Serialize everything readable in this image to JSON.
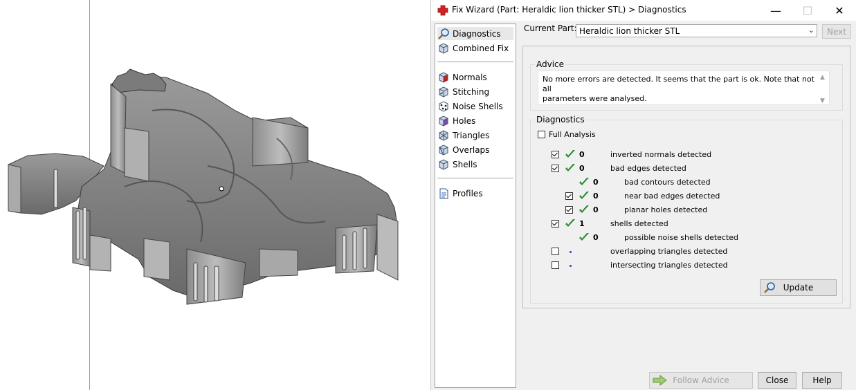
{
  "window": {
    "title": "Fix Wizard (Part: Heraldic lion thicker STL) > Diagnostics"
  },
  "nav": {
    "items": [
      {
        "label": "Diagnostics",
        "icon": "magnifier-icon"
      },
      {
        "label": "Combined Fix",
        "icon": "cube-icon"
      },
      {
        "label": "Normals",
        "icon": "normals-cube-icon"
      },
      {
        "label": "Stitching",
        "icon": "stitching-cube-icon"
      },
      {
        "label": "Noise Shells",
        "icon": "noise-shells-icon"
      },
      {
        "label": "Holes",
        "icon": "holes-cube-icon"
      },
      {
        "label": "Triangles",
        "icon": "triangles-cube-icon"
      },
      {
        "label": "Overlaps",
        "icon": "overlaps-cube-icon"
      },
      {
        "label": "Shells",
        "icon": "shells-cube-icon"
      },
      {
        "label": "Profiles",
        "icon": "profiles-document-icon"
      }
    ]
  },
  "current_part": {
    "label": "Current Part:",
    "value": "Heraldic lion thicker STL",
    "next_label": "Next"
  },
  "advice": {
    "title": "Advice",
    "line1": "No more errors are detected. It seems that the part is ok. Note that not all",
    "line2": "parameters were analysed."
  },
  "diagnostics": {
    "title": "Diagnostics",
    "full_analysis_label": "Full Analysis",
    "rows": [
      {
        "count": "0",
        "label": "inverted normals detected"
      },
      {
        "count": "0",
        "label": "bad edges detected"
      },
      {
        "count": "0",
        "label": "bad contours detected"
      },
      {
        "count": "0",
        "label": "near bad edges detected"
      },
      {
        "count": "0",
        "label": "planar holes detected"
      },
      {
        "count": "1",
        "label": "shells detected"
      },
      {
        "count": "0",
        "label": "possible noise shells detected"
      },
      {
        "count": "",
        "label": "overlapping triangles detected"
      },
      {
        "count": "",
        "label": "intersecting triangles detected"
      }
    ],
    "update_label": "Update"
  },
  "footer": {
    "follow_advice_label": "Follow Advice",
    "close_label": "Close",
    "help_label": "Help"
  },
  "colors": {
    "ok_tick": "#2e8b2e",
    "title_icon": "#d42020",
    "viewport_line": "#5fa8d3"
  }
}
